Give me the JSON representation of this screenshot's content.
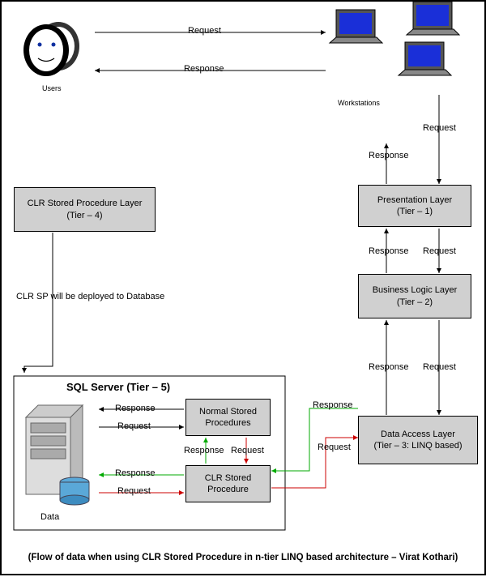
{
  "usersLabel": "Users",
  "workstationsLabel": "Workstations",
  "userToWs": {
    "request": "Request",
    "response": "Response"
  },
  "wsToPresentation": {
    "request": "Request",
    "response": "Response"
  },
  "presentation": {
    "title": "Presentation Layer",
    "sub": "(Tier – 1)"
  },
  "presToBusiness": {
    "request": "Request",
    "response": "Response"
  },
  "business": {
    "title": "Business Logic Layer",
    "sub": "(Tier – 2)"
  },
  "busToDal": {
    "request": "Request",
    "response": "Response"
  },
  "dal": {
    "title": "Data Access Layer",
    "sub": "(Tier – 3: LINQ based)"
  },
  "clrLayer": {
    "title": "CLR Stored Procedure Layer",
    "sub": "(Tier – 4)"
  },
  "clrDeployNote": "CLR SP will be deployed to Database",
  "sqlServer": {
    "title": "SQL Server (Tier – 5)"
  },
  "normalSP": {
    "l1": "Normal Stored",
    "l2": "Procedures"
  },
  "clrSP": {
    "l1": "CLR Stored",
    "l2": "Procedure"
  },
  "dataLabel": "Data",
  "dataToNormal": {
    "request": "Request",
    "response": "Response"
  },
  "dataToCLR": {
    "request": "Request",
    "response": "Response"
  },
  "normalToCLR": {
    "request": "Request",
    "response": "Response"
  },
  "dalToCLR": {
    "request": "Request",
    "response": "Response"
  },
  "caption": "(Flow of data when using CLR Stored Procedure in n-tier LINQ based architecture – Virat Kothari)"
}
